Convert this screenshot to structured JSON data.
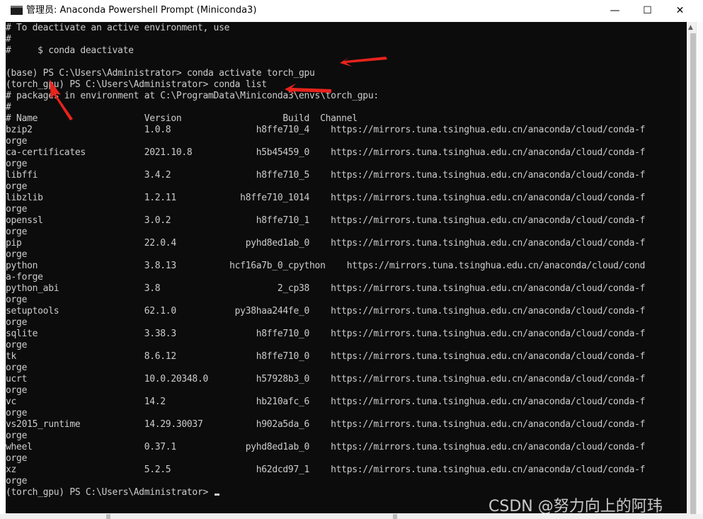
{
  "window": {
    "title": "管理员: Anaconda Powershell Prompt (Miniconda3)",
    "minimize_glyph": "—",
    "maximize_glyph": "☐",
    "close_glyph": "✕"
  },
  "terminal": {
    "lines": [
      "# To deactivate an active environment, use",
      "#",
      "#     $ conda deactivate",
      "",
      "(base) PS C:\\Users\\Administrator> conda activate torch_gpu",
      "(torch_gpu) PS C:\\Users\\Administrator> conda list",
      "# packages in environment at C:\\ProgramData\\Miniconda3\\envs\\torch_gpu:",
      "#",
      "# Name                    Version                   Build  Channel",
      "bzip2                     1.0.8                h8ffe710_4    https://mirrors.tuna.tsinghua.edu.cn/anaconda/cloud/conda-f",
      "orge",
      "ca-certificates           2021.10.8            h5b45459_0    https://mirrors.tuna.tsinghua.edu.cn/anaconda/cloud/conda-f",
      "orge",
      "libffi                    3.4.2                h8ffe710_5    https://mirrors.tuna.tsinghua.edu.cn/anaconda/cloud/conda-f",
      "orge",
      "libzlib                   1.2.11            h8ffe710_1014    https://mirrors.tuna.tsinghua.edu.cn/anaconda/cloud/conda-f",
      "orge",
      "openssl                   3.0.2                h8ffe710_1    https://mirrors.tuna.tsinghua.edu.cn/anaconda/cloud/conda-f",
      "orge",
      "pip                       22.0.4             pyhd8ed1ab_0    https://mirrors.tuna.tsinghua.edu.cn/anaconda/cloud/conda-f",
      "orge",
      "python                    3.8.13          hcf16a7b_0_cpython    https://mirrors.tuna.tsinghua.edu.cn/anaconda/cloud/cond",
      "a-forge",
      "python_abi                3.8                      2_cp38    https://mirrors.tuna.tsinghua.edu.cn/anaconda/cloud/conda-f",
      "orge",
      "setuptools                62.1.0           py38haa244fe_0    https://mirrors.tuna.tsinghua.edu.cn/anaconda/cloud/conda-f",
      "orge",
      "sqlite                    3.38.3               h8ffe710_0    https://mirrors.tuna.tsinghua.edu.cn/anaconda/cloud/conda-f",
      "orge",
      "tk                        8.6.12               h8ffe710_0    https://mirrors.tuna.tsinghua.edu.cn/anaconda/cloud/conda-f",
      "orge",
      "ucrt                      10.0.20348.0         h57928b3_0    https://mirrors.tuna.tsinghua.edu.cn/anaconda/cloud/conda-f",
      "orge",
      "vc                        14.2                 hb210afc_6    https://mirrors.tuna.tsinghua.edu.cn/anaconda/cloud/conda-f",
      "orge",
      "vs2015_runtime            14.29.30037          h902a5da_6    https://mirrors.tuna.tsinghua.edu.cn/anaconda/cloud/conda-f",
      "orge",
      "wheel                     0.37.1             pyhd8ed1ab_0    https://mirrors.tuna.tsinghua.edu.cn/anaconda/cloud/conda-f",
      "orge",
      "xz                        5.2.5                h62dcd97_1    https://mirrors.tuna.tsinghua.edu.cn/anaconda/cloud/conda-f",
      "orge"
    ],
    "prompt": "(torch_gpu) PS C:\\Users\\Administrator> "
  },
  "watermark": "CSDN @努力向上的阿玮",
  "colors": {
    "console_bg": "#0c0c0c",
    "console_text": "#cccccc",
    "annotation_arrow": "#e8231c"
  },
  "icons": {
    "app": "terminal-icon"
  }
}
